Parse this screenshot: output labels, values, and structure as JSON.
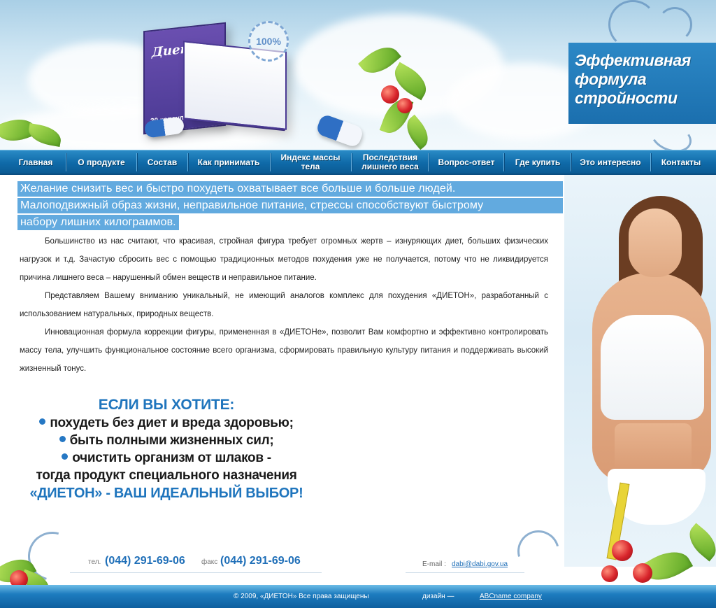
{
  "header": {
    "slogan_lines": [
      "Эффективная",
      "формула",
      "стройности"
    ],
    "box_brand": "Диетон",
    "box_count": "30 капсул",
    "seal_text": "100%"
  },
  "nav": {
    "items": [
      {
        "label": "Главная"
      },
      {
        "label": "О продукте"
      },
      {
        "label": "Состав"
      },
      {
        "label": "Как принимать"
      },
      {
        "label": "Индекс массы тела"
      },
      {
        "label": "Последствия лишнего веса"
      },
      {
        "label": "Вопрос-ответ"
      },
      {
        "label": "Где купить"
      },
      {
        "label": "Это интересно"
      },
      {
        "label": "Контакты"
      }
    ]
  },
  "lead": {
    "lines": [
      "Желание снизить вес и быстро похудеть охватывает все больше и больше людей.",
      "Малоподвижный образ жизни, неправильное питание, стрессы способствуют быстрому",
      "набору лишних килограммов."
    ]
  },
  "body": {
    "paragraphs": [
      "Большинство из нас считают, что красивая, стройная фигура требует огромных жертв – изнуряющих диет, больших физических нагрузок и т.д. Зачастую сбросить вес с помощью традиционных методов похудения уже не получается, потому что не ликвидируется причина лишнего веса – нарушенный обмен веществ и неправильное питание.",
      "Представляем Вашему вниманию уникальный, не имеющий аналогов комплекс для похудения «ДИЕТОН», разработанный с использованием натуральных, природных веществ.",
      "Инновационная формула коррекции фигуры, примененная в «ДИЕТОНе», позволит Вам комфортно и эффективно контролировать массу тела, улучшить функциональное состояние всего организма, сформировать правильную культуру питания и поддерживать высокий жизненный тонус."
    ]
  },
  "promo": {
    "heading": "ЕСЛИ ВЫ ХОТИТЕ:",
    "items": [
      "похудеть без диет и вреда здоровью;",
      "быть полными жизненных сил;",
      "очистить организм от шлаков -"
    ],
    "line_after": "тогда продукт специального назначения",
    "closing": "«ДИЕТОН» - ВАШ ИДЕАЛЬНЫЙ ВЫБОР!"
  },
  "contacts": {
    "tel_label": "тел.",
    "tel_number": "(044) 291-69-06",
    "fax_label": "факс",
    "fax_number": "(044) 291-69-06",
    "email_label": "E-mail :",
    "email": "dabi@dabi.gov.ua"
  },
  "footer": {
    "copyright": "© 2009, «ДИЕТОН» Все права защищены",
    "design_label": "дизайн —",
    "design_link": "ABCname company"
  },
  "colors": {
    "accent": "#1f75bd",
    "nav_bg": "#0f6aa8",
    "lead_bg": "#62aadf",
    "slogan_bg": "#2c88c6"
  },
  "icons": [
    "capsule-icon",
    "leaf-icon",
    "berry-icon",
    "swirl-ornament-icon",
    "bullet-dot-icon"
  ]
}
